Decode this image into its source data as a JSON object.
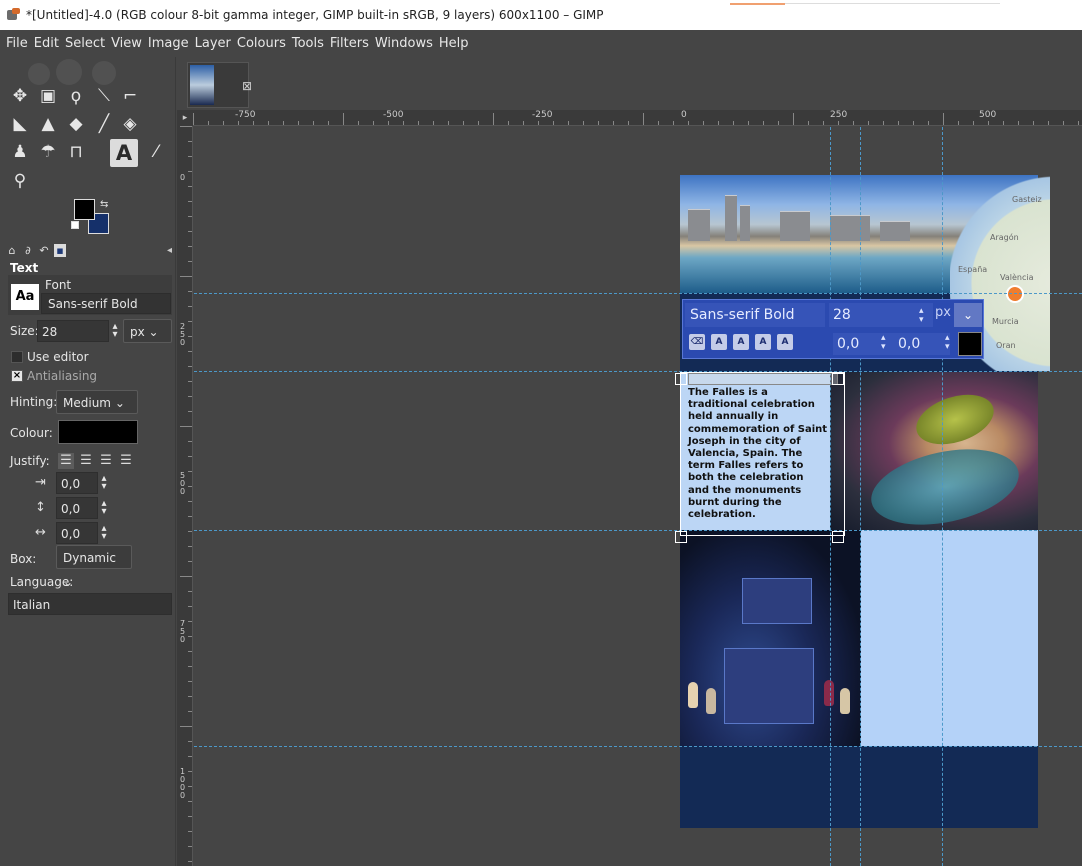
{
  "window": {
    "title": "*[Untitled]-4.0 (RGB colour 8-bit gamma integer, GIMP built-in sRGB, 9 layers) 600x1100 – GIMP"
  },
  "menu": [
    "File",
    "Edit",
    "Select",
    "View",
    "Image",
    "Layer",
    "Colours",
    "Tools",
    "Filters",
    "Windows",
    "Help"
  ],
  "toolbox": {
    "tools": [
      "move-tool",
      "rect-select-tool",
      "free-select-tool",
      "fuzzy-select-tool",
      "crop-tool",
      "warp-tool",
      "clone-tool",
      "bucket-fill-tool",
      "paintbrush-tool",
      "eraser-tool",
      "dodge-tool",
      "smudge-tool",
      "paths-tool",
      "text-tool",
      "color-picker-tool",
      "zoom-tool"
    ],
    "active_tool": "text-tool",
    "fg_color": "#000000",
    "bg_color": "#15306a"
  },
  "tool_options": {
    "title": "Text",
    "font_label": "Font",
    "font_value": "Sans-serif Bold",
    "size_label": "Size:",
    "size_value": "28",
    "size_unit": "px",
    "use_editor_label": "Use editor",
    "antialiasing_label": "Antialiasing",
    "antialiasing_checked": true,
    "hinting_label": "Hinting:",
    "hinting_value": "Medium",
    "colour_label": "Colour:",
    "colour_value": "#000000",
    "justify_label": "Justify:",
    "indent_value": "0,0",
    "line_spacing_value": "0,0",
    "letter_spacing_value": "0,0",
    "box_label": "Box:",
    "box_value": "Dynamic",
    "language_label": "Language:",
    "language_value": "Italian"
  },
  "rulers": {
    "horizontal_labels": [
      "-750",
      "-500",
      "-250",
      "0",
      "250",
      "500"
    ],
    "vertical_labels": [
      "0",
      "250",
      "500",
      "750",
      "1000"
    ]
  },
  "canvas": {
    "text_layer": "The Falles is a traditional celebration held annually in commemoration of Saint Joseph in the city of Valencia, Spain. The term Falles refers to both the celebration and the monuments burnt during the celebration.",
    "map_labels": [
      "Gasteiz",
      "Aragón",
      "España",
      "València",
      "Murcia",
      "Oran"
    ],
    "text_editor": {
      "font": "Sans-serif Bold",
      "size": "28",
      "unit": "px",
      "baseline_offset": "0,0",
      "kerning": "0,0",
      "color": "#000000"
    }
  }
}
